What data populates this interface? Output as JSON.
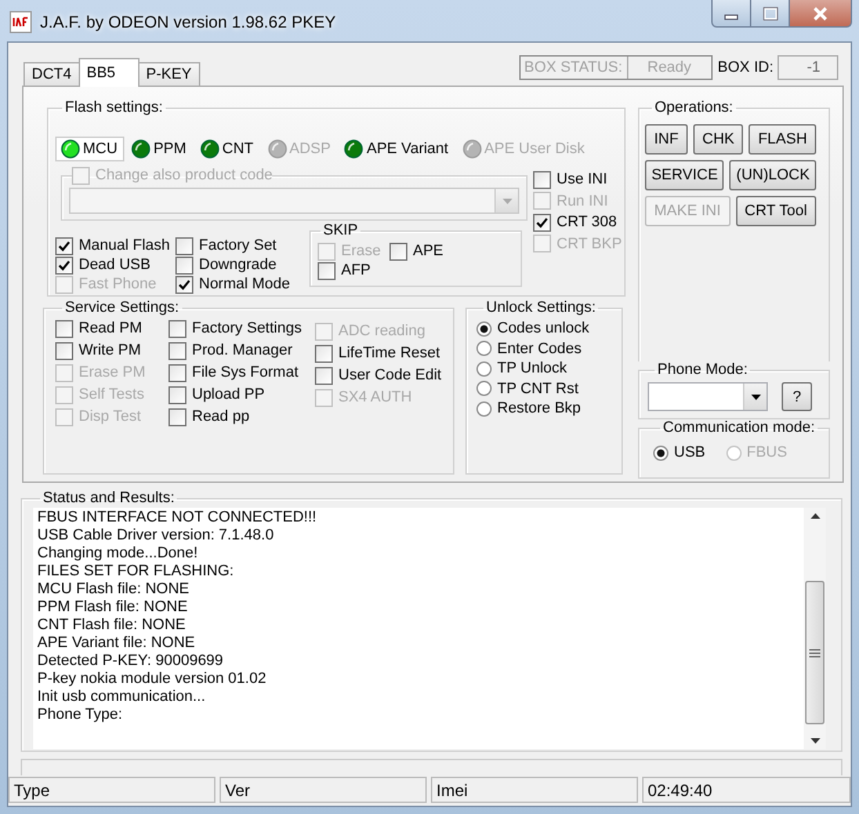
{
  "window": {
    "title": "J.A.F. by ODEON version 1.98.62 PKEY"
  },
  "tabs": [
    {
      "label": "DCT4",
      "selected": false
    },
    {
      "label": "BB5",
      "selected": true
    },
    {
      "label": "P-KEY",
      "selected": false
    }
  ],
  "box_status": {
    "label": "BOX STATUS:",
    "value": "Ready"
  },
  "box_id": {
    "label": "BOX ID:",
    "value": "-1"
  },
  "flash_settings": {
    "title": "Flash settings:",
    "indicators": [
      {
        "label": "MCU",
        "selected": true,
        "disabled": false
      },
      {
        "label": "PPM",
        "selected": false,
        "disabled": false
      },
      {
        "label": "CNT",
        "selected": false,
        "disabled": false
      },
      {
        "label": "ADSP",
        "selected": false,
        "disabled": true
      },
      {
        "label": "APE Variant",
        "selected": false,
        "disabled": false
      },
      {
        "label": "APE User Disk",
        "selected": false,
        "disabled": true
      }
    ],
    "product_code": {
      "label": "Change also product code",
      "checked": false,
      "disabled": true
    },
    "options": [
      [
        {
          "label": "Manual Flash",
          "checked": true,
          "disabled": false
        },
        {
          "label": "Dead USB",
          "checked": true,
          "disabled": false
        },
        {
          "label": "Fast Phone",
          "checked": false,
          "disabled": true
        }
      ],
      [
        {
          "label": "Factory Set",
          "checked": false,
          "disabled": false
        },
        {
          "label": "Downgrade",
          "checked": false,
          "disabled": false
        },
        {
          "label": "Normal Mode",
          "checked": true,
          "disabled": false
        }
      ]
    ],
    "skip": {
      "title": "SKIP",
      "options": [
        {
          "label": "Erase",
          "checked": false,
          "disabled": true
        },
        {
          "label": "APE",
          "checked": false,
          "disabled": false
        },
        {
          "label": "AFP",
          "checked": false,
          "disabled": false
        }
      ]
    },
    "ini_options": [
      {
        "label": "Use INI",
        "checked": false,
        "disabled": false
      },
      {
        "label": "Run INI",
        "checked": false,
        "disabled": true
      },
      {
        "label": "CRT 308",
        "checked": true,
        "disabled": false
      },
      {
        "label": "CRT BKP",
        "checked": false,
        "disabled": true
      }
    ]
  },
  "service_settings": {
    "title": "Service Settings:",
    "columns": [
      [
        {
          "label": "Read PM",
          "checked": false,
          "disabled": false
        },
        {
          "label": "Write PM",
          "checked": false,
          "disabled": false
        },
        {
          "label": "Erase PM",
          "checked": false,
          "disabled": true
        },
        {
          "label": "Self Tests",
          "checked": false,
          "disabled": true
        },
        {
          "label": "Disp Test",
          "checked": false,
          "disabled": true
        }
      ],
      [
        {
          "label": "Factory Settings",
          "checked": false,
          "disabled": false
        },
        {
          "label": "Prod. Manager",
          "checked": false,
          "disabled": false
        },
        {
          "label": "File Sys Format",
          "checked": false,
          "disabled": false
        },
        {
          "label": "Upload PP",
          "checked": false,
          "disabled": false
        },
        {
          "label": "Read pp",
          "checked": false,
          "disabled": false
        }
      ],
      [
        {
          "label": "ADC reading",
          "checked": false,
          "disabled": true
        },
        {
          "label": "LifeTime Reset",
          "checked": false,
          "disabled": false
        },
        {
          "label": "User Code Edit",
          "checked": false,
          "disabled": false
        },
        {
          "label": "SX4 AUTH",
          "checked": false,
          "disabled": true
        }
      ]
    ]
  },
  "unlock_settings": {
    "title": "Unlock Settings:",
    "options": [
      {
        "label": "Codes unlock",
        "selected": true
      },
      {
        "label": "Enter Codes",
        "selected": false
      },
      {
        "label": "TP Unlock",
        "selected": false
      },
      {
        "label": "TP CNT Rst",
        "selected": false
      },
      {
        "label": "Restore Bkp",
        "selected": false
      }
    ]
  },
  "operations": {
    "title": "Operations:",
    "buttons": [
      {
        "label": "INF",
        "disabled": false
      },
      {
        "label": "CHK",
        "disabled": false
      },
      {
        "label": "FLASH",
        "disabled": false
      },
      {
        "label": "SERVICE",
        "disabled": false
      },
      {
        "label": "(UN)LOCK",
        "disabled": false
      },
      {
        "label": "MAKE INI",
        "disabled": true
      },
      {
        "label": "CRT Tool",
        "disabled": false
      }
    ]
  },
  "phone_mode": {
    "title": "Phone Mode:",
    "help_button": "?"
  },
  "communication_mode": {
    "title": "Communication mode:",
    "options": [
      {
        "label": "USB",
        "selected": true,
        "disabled": false
      },
      {
        "label": "FBUS",
        "selected": false,
        "disabled": true
      }
    ]
  },
  "status": {
    "title": "Status and Results:",
    "lines": [
      "FBUS INTERFACE NOT CONNECTED!!!",
      "USB Cable Driver version: 7.1.48.0",
      "Changing mode...Done!",
      "FILES SET FOR FLASHING:",
      "MCU Flash file: NONE",
      "PPM Flash file: NONE",
      "CNT Flash file: NONE",
      "APE Variant file: NONE",
      "Detected P-KEY: 90009699",
      "P-key nokia module version 01.02",
      "Init usb communication...",
      "Phone Type:"
    ]
  },
  "progress": {
    "level": 0
  },
  "status_bar": [
    "Type",
    "Ver",
    "Imei",
    "02:49:40"
  ]
}
